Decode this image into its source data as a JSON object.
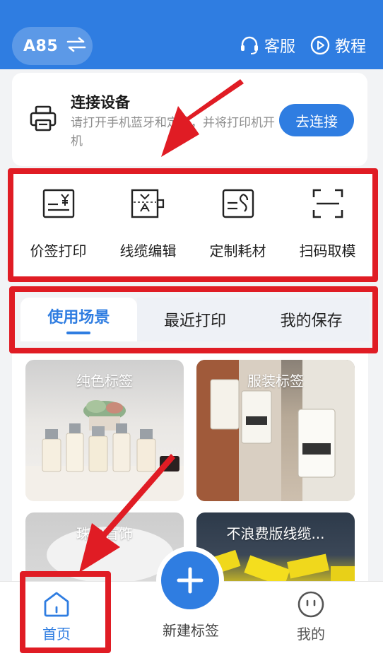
{
  "header": {
    "device_model": "A85",
    "swap_icon": "swap-arrows-icon",
    "service_label": "客服",
    "tutorial_label": "教程"
  },
  "connect": {
    "title": "连接设备",
    "description": "请打开手机蓝牙和定位，并将打印机开机",
    "button": "去连接"
  },
  "quick_actions": [
    {
      "label": "价签打印",
      "icon": "price-tag-icon"
    },
    {
      "label": "线缆编辑",
      "icon": "cable-label-icon"
    },
    {
      "label": "定制耗材",
      "icon": "custom-supplies-icon"
    },
    {
      "label": "扫码取模",
      "icon": "scan-icon"
    }
  ],
  "tabs": [
    {
      "label": "使用场景",
      "active": true
    },
    {
      "label": "最近打印",
      "active": false
    },
    {
      "label": "我的保存",
      "active": false
    }
  ],
  "scenes": [
    {
      "label": "纯色标签"
    },
    {
      "label": "服装标签"
    },
    {
      "label": "珠宝首饰"
    },
    {
      "label": "不浪费版线缆..."
    }
  ],
  "bottom_nav": {
    "home": "首页",
    "new_label": "新建标签",
    "mine": "我的"
  },
  "colors": {
    "primary": "#2f7de1",
    "highlight": "#e01c24"
  }
}
